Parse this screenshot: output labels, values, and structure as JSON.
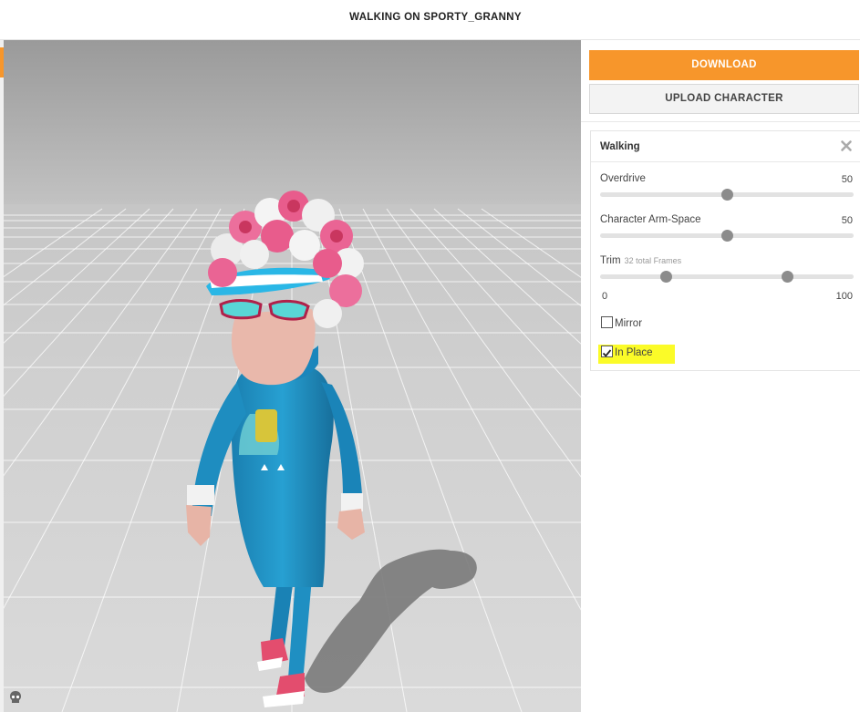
{
  "header": {
    "title": "WALKING ON SPORTY_GRANNY"
  },
  "sidebar": {
    "download_label": "DOWNLOAD",
    "upload_label": "UPLOAD CHARACTER",
    "panel": {
      "title": "Walking",
      "overdrive": {
        "label": "Overdrive",
        "value": "50",
        "fraction": 0.5
      },
      "arm_space": {
        "label": "Character Arm-Space",
        "value": "50",
        "fraction": 0.5
      },
      "trim": {
        "label": "Trim",
        "sublabel": "32 total Frames",
        "min": "0",
        "max": "100",
        "start_fraction": 0.26,
        "end_fraction": 0.74
      },
      "mirror": {
        "label": "Mirror",
        "checked": false
      },
      "in_place": {
        "label": "In Place",
        "checked": true
      }
    }
  },
  "colors": {
    "accent": "#f7962b",
    "highlight": "#fbfb28",
    "suit": "#1e8fc0"
  },
  "icons": {
    "close": "close-icon",
    "brand": "skull-icon"
  }
}
